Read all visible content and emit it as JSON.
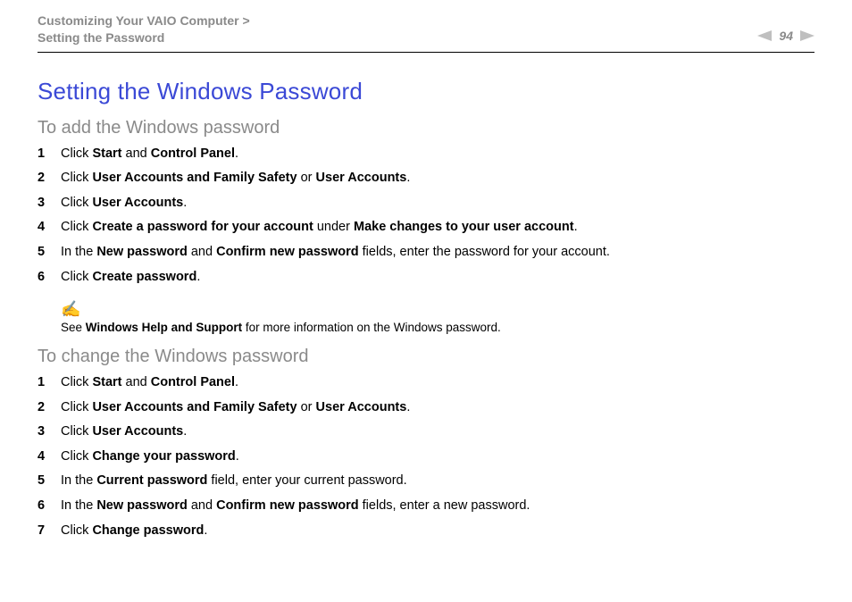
{
  "header": {
    "bc1": "Customizing Your VAIO Computer",
    "bc_sep": " > ",
    "bc2": "Setting the Password",
    "page_number": "94"
  },
  "title": "Setting the Windows Password",
  "section_add": {
    "heading": "To add the Windows password",
    "steps": [
      {
        "n": "1",
        "pre": "Click ",
        "b1": "Start",
        "mid": " and ",
        "b2": "Control Panel",
        "post": "."
      },
      {
        "n": "2",
        "pre": "Click ",
        "b1": "User Accounts and Family Safety",
        "mid": " or ",
        "b2": "User Accounts",
        "post": "."
      },
      {
        "n": "3",
        "pre": "Click ",
        "b1": "User Accounts",
        "mid": "",
        "b2": "",
        "post": "."
      },
      {
        "n": "4",
        "pre": "Click ",
        "b1": "Create a password for your account",
        "mid": " under ",
        "b2": "Make changes to your user account",
        "post": "."
      },
      {
        "n": "5",
        "pre": "In the ",
        "b1": "New password",
        "mid": " and ",
        "b2": "Confirm new password",
        "post": " fields, enter the password for your account."
      },
      {
        "n": "6",
        "pre": "Click ",
        "b1": "Create password",
        "mid": "",
        "b2": "",
        "post": "."
      }
    ]
  },
  "note": {
    "icon": "✍",
    "pre": "See ",
    "b": "Windows Help and Support",
    "post": " for more information on the Windows password."
  },
  "section_change": {
    "heading": "To change the Windows password",
    "steps": [
      {
        "n": "1",
        "pre": "Click ",
        "b1": "Start",
        "mid": " and ",
        "b2": "Control Panel",
        "post": "."
      },
      {
        "n": "2",
        "pre": "Click ",
        "b1": "User Accounts and Family Safety",
        "mid": " or ",
        "b2": "User Accounts",
        "post": "."
      },
      {
        "n": "3",
        "pre": "Click ",
        "b1": "User Accounts",
        "mid": "",
        "b2": "",
        "post": "."
      },
      {
        "n": "4",
        "pre": "Click ",
        "b1": "Change your password",
        "mid": "",
        "b2": "",
        "post": "."
      },
      {
        "n": "5",
        "pre": "In the ",
        "b1": "Current password",
        "mid": "",
        "b2": "",
        "post": " field, enter your current password."
      },
      {
        "n": "6",
        "pre": "In the ",
        "b1": "New password",
        "mid": " and ",
        "b2": "Confirm new password",
        "post": " fields, enter a new password."
      },
      {
        "n": "7",
        "pre": "Click ",
        "b1": "Change password",
        "mid": "",
        "b2": "",
        "post": "."
      }
    ]
  }
}
